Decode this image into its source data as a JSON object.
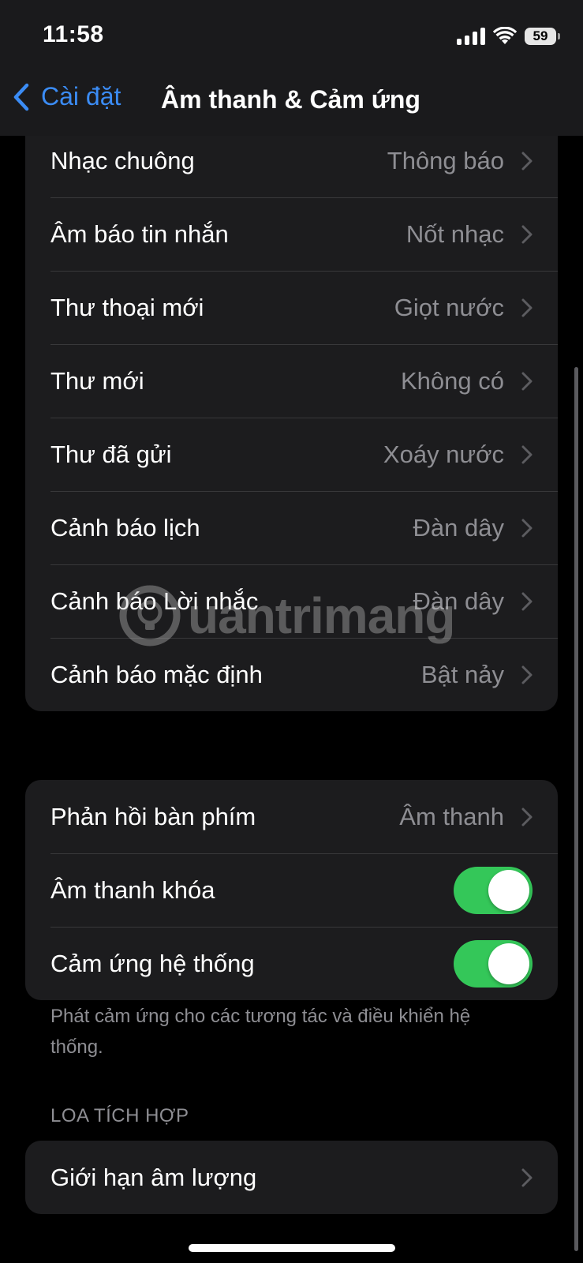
{
  "status_bar": {
    "time": "11:58",
    "battery_level": "59"
  },
  "nav": {
    "back_label": "Cài đặt",
    "title": "Âm thanh & Cảm ứng"
  },
  "sounds_group": {
    "rows": [
      {
        "label": "Nhạc chuông",
        "value": "Thông báo"
      },
      {
        "label": "Âm báo tin nhắn",
        "value": "Nốt nhạc"
      },
      {
        "label": "Thư thoại mới",
        "value": "Giọt nước"
      },
      {
        "label": "Thư mới",
        "value": "Không có"
      },
      {
        "label": "Thư đã gửi",
        "value": "Xoáy nước"
      },
      {
        "label": "Cảnh báo lịch",
        "value": "Đàn dây"
      },
      {
        "label": "Cảnh báo Lời nhắc",
        "value": "Đàn dây"
      },
      {
        "label": "Cảnh báo mặc định",
        "value": "Bật nảy"
      }
    ]
  },
  "feedback_group": {
    "keyboard_feedback": {
      "label": "Phản hồi bàn phím",
      "value": "Âm thanh"
    },
    "lock_sound": {
      "label": "Âm thanh khóa",
      "on": true
    },
    "system_haptics": {
      "label": "Cảm ứng hệ thống",
      "on": true
    }
  },
  "footnote": "Phát cảm ứng cho các tương tác và điều khiển hệ thống.",
  "builtin_speaker": {
    "header": "LOA TÍCH HỢP",
    "volume_limit": {
      "label": "Giới hạn âm lượng"
    }
  },
  "watermark": "uantrimang",
  "colors": {
    "accent": "#3b8cf5",
    "toggle_on": "#34c759",
    "group_bg": "#1c1c1e",
    "secondary_text": "#8e8e93"
  }
}
